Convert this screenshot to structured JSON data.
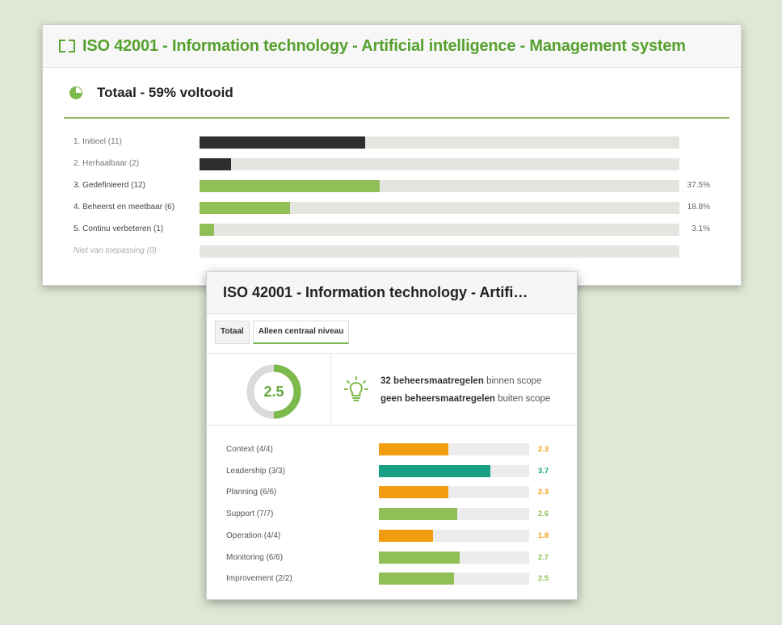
{
  "panel1": {
    "title": "ISO 42001 - Information technology - Artificial intelligence - Management system",
    "icon": "expand-icon",
    "total_label": "Totaal - 59% voltooid",
    "levels": [
      {
        "label": "1. Initieel (11)",
        "fraction": 0.345,
        "color": "#2d2d2d",
        "pct": "",
        "style": "muted"
      },
      {
        "label": "2. Herhaalbaar (2)",
        "fraction": 0.065,
        "color": "#2d2d2d",
        "pct": "",
        "style": "muted"
      },
      {
        "label": "3. Gedefinieerd (12)",
        "fraction": 0.375,
        "color": "#8fbf56",
        "pct": "37.5%",
        "style": "strong"
      },
      {
        "label": "4. Beheerst en meetbaar (6)",
        "fraction": 0.188,
        "color": "#8fbf56",
        "pct": "18.8%",
        "style": "strong"
      },
      {
        "label": "5. Continu verbeteren (1)",
        "fraction": 0.031,
        "color": "#8fbf56",
        "pct": "3.1%",
        "style": "strong"
      },
      {
        "label": "Niet van toepassing (0)",
        "fraction": 0,
        "color": "#8fbf56",
        "pct": "",
        "style": "na"
      }
    ]
  },
  "panel2": {
    "title": "ISO 42001 - Information technology - Artifi…",
    "tabs": [
      {
        "label": "Totaal",
        "active": false
      },
      {
        "label": "Alleen centraal niveau",
        "active": true
      }
    ],
    "score": "2.5",
    "score_fraction": 0.5,
    "stats": {
      "in_scope_bold": "32 beheersmaatregelen",
      "in_scope_rest": "binnen scope",
      "out_scope_bold": "geen beheersmaatregelen",
      "out_scope_rest": "buiten scope"
    },
    "categories": [
      {
        "label": "Context (4/4)",
        "value": "2.3",
        "fraction": 0.46,
        "color": "#f39c12"
      },
      {
        "label": "Leadership (3/3)",
        "value": "3.7",
        "fraction": 0.74,
        "color": "#16a085"
      },
      {
        "label": "Planning (6/6)",
        "value": "2.3",
        "fraction": 0.46,
        "color": "#f39c12"
      },
      {
        "label": "Support (7/7)",
        "value": "2.6",
        "fraction": 0.52,
        "color": "#8fbf56"
      },
      {
        "label": "Operation (4/4)",
        "value": "1.8",
        "fraction": 0.36,
        "color": "#f39c12"
      },
      {
        "label": "Monitoring (6/6)",
        "value": "2.7",
        "fraction": 0.54,
        "color": "#8fbf56"
      },
      {
        "label": "Improvement (2/2)",
        "value": "2.5",
        "fraction": 0.5,
        "color": "#8fbf56"
      }
    ]
  }
}
